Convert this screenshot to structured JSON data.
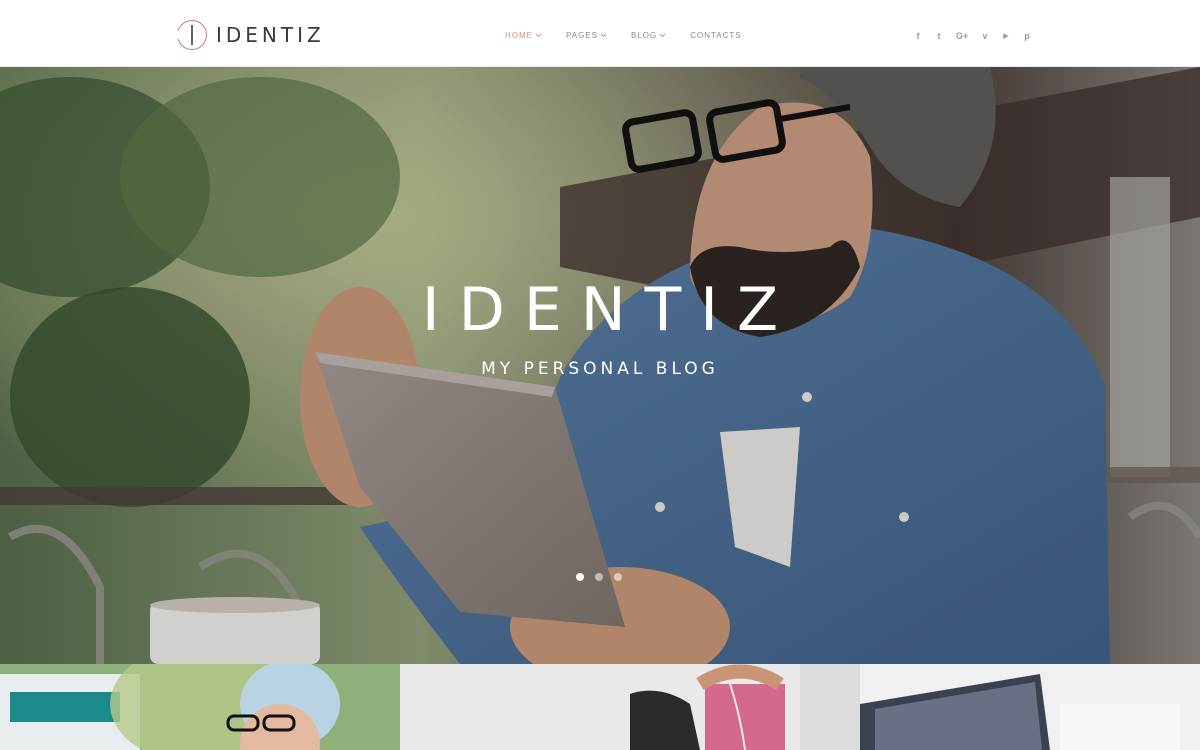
{
  "header": {
    "logo_text": "IDENTIZ",
    "nav": [
      {
        "label": "HOME",
        "active": true,
        "has_dropdown": true
      },
      {
        "label": "PAGES",
        "active": false,
        "has_dropdown": true
      },
      {
        "label": "BLOG",
        "active": false,
        "has_dropdown": true
      },
      {
        "label": "CONTACTS",
        "active": false,
        "has_dropdown": false
      }
    ],
    "social": [
      {
        "icon": "facebook-icon",
        "glyph": "f"
      },
      {
        "icon": "twitter-icon",
        "glyph": "t"
      },
      {
        "icon": "google-plus-icon",
        "glyph": "G+"
      },
      {
        "icon": "vimeo-icon",
        "glyph": "v"
      },
      {
        "icon": "youtube-icon",
        "glyph": "▶"
      },
      {
        "icon": "pinterest-icon",
        "glyph": "p"
      }
    ]
  },
  "hero": {
    "title": "IDENTIZ",
    "subtitle": "MY PERSONAL BLOG",
    "slides": 3,
    "active_slide": 1
  },
  "colors": {
    "accent": "#d48d86",
    "nav_text": "#8a8a8a",
    "logo_text": "#3a3a3a"
  }
}
